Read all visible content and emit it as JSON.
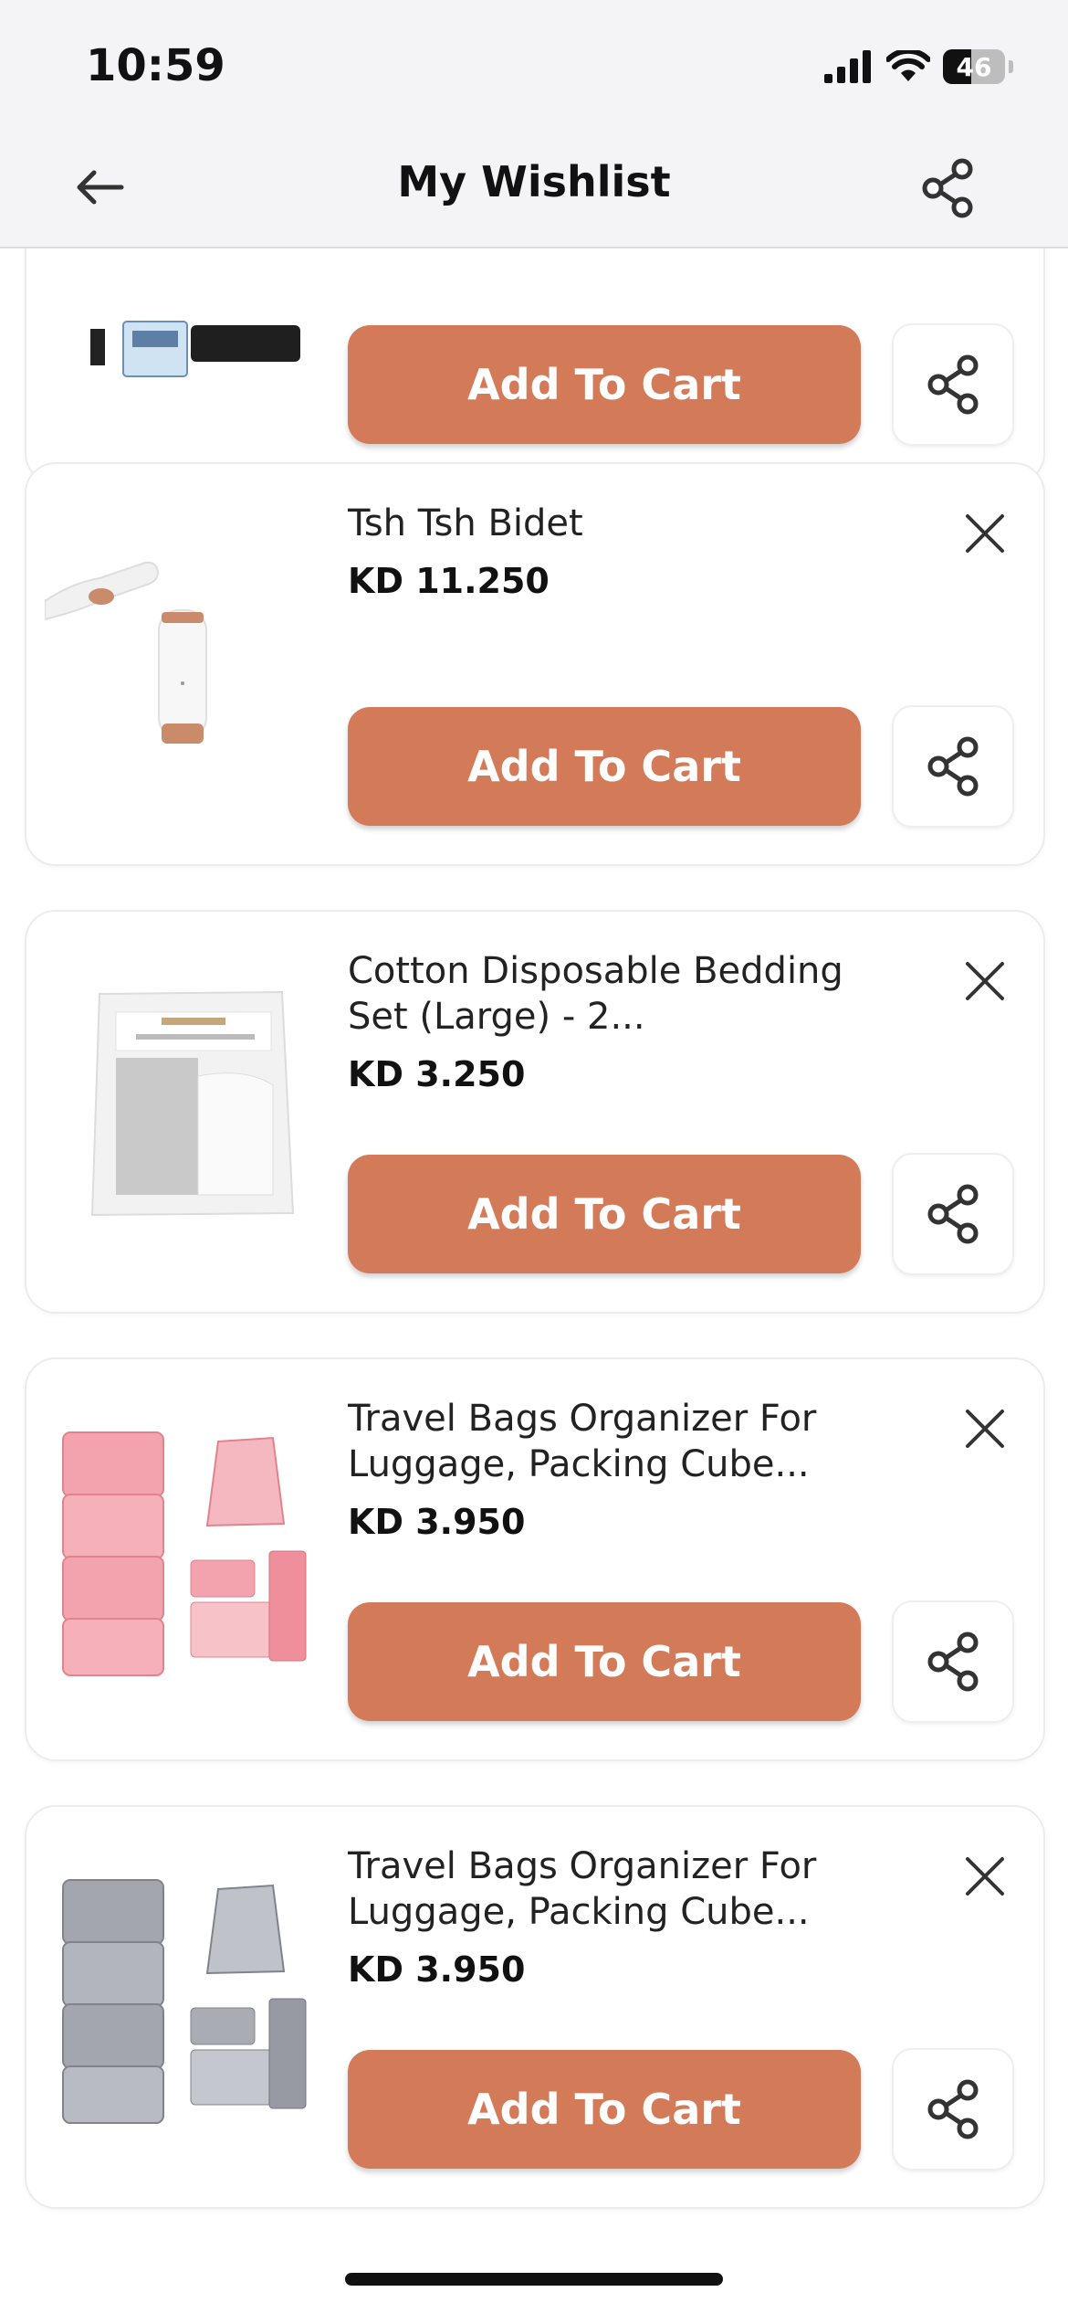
{
  "status_bar": {
    "time": "10:59",
    "battery_level": "46"
  },
  "header": {
    "title": "My Wishlist",
    "back_icon": "arrow-left-icon",
    "share_icon": "share-icon"
  },
  "colors": {
    "accent": "#d37a59",
    "background": "#ffffff",
    "header_bg": "#f4f4f6"
  },
  "wishlist": {
    "items": [
      {
        "title": "",
        "price": "",
        "add_to_cart_label": "Add To Cart",
        "image": "travel-tag-product-image"
      },
      {
        "title": "Tsh Tsh Bidet",
        "price": "KD 11.250",
        "add_to_cart_label": "Add To Cart",
        "image": "portable-bidet-image"
      },
      {
        "title": "Cotton Disposable Bedding Set (Large) - 2...",
        "price": "KD 3.250",
        "add_to_cart_label": "Add To Cart",
        "image": "bedding-set-package-image"
      },
      {
        "title": "Travel Bags Organizer For Luggage, Packing Cube...",
        "price": "KD 3.950",
        "add_to_cart_label": "Add To Cart",
        "image": "pink-packing-cubes-image"
      },
      {
        "title": "Travel Bags Organizer For Luggage, Packing Cube...",
        "price": "KD 3.950",
        "add_to_cart_label": "Add To Cart",
        "image": "grey-packing-cubes-image"
      }
    ]
  }
}
